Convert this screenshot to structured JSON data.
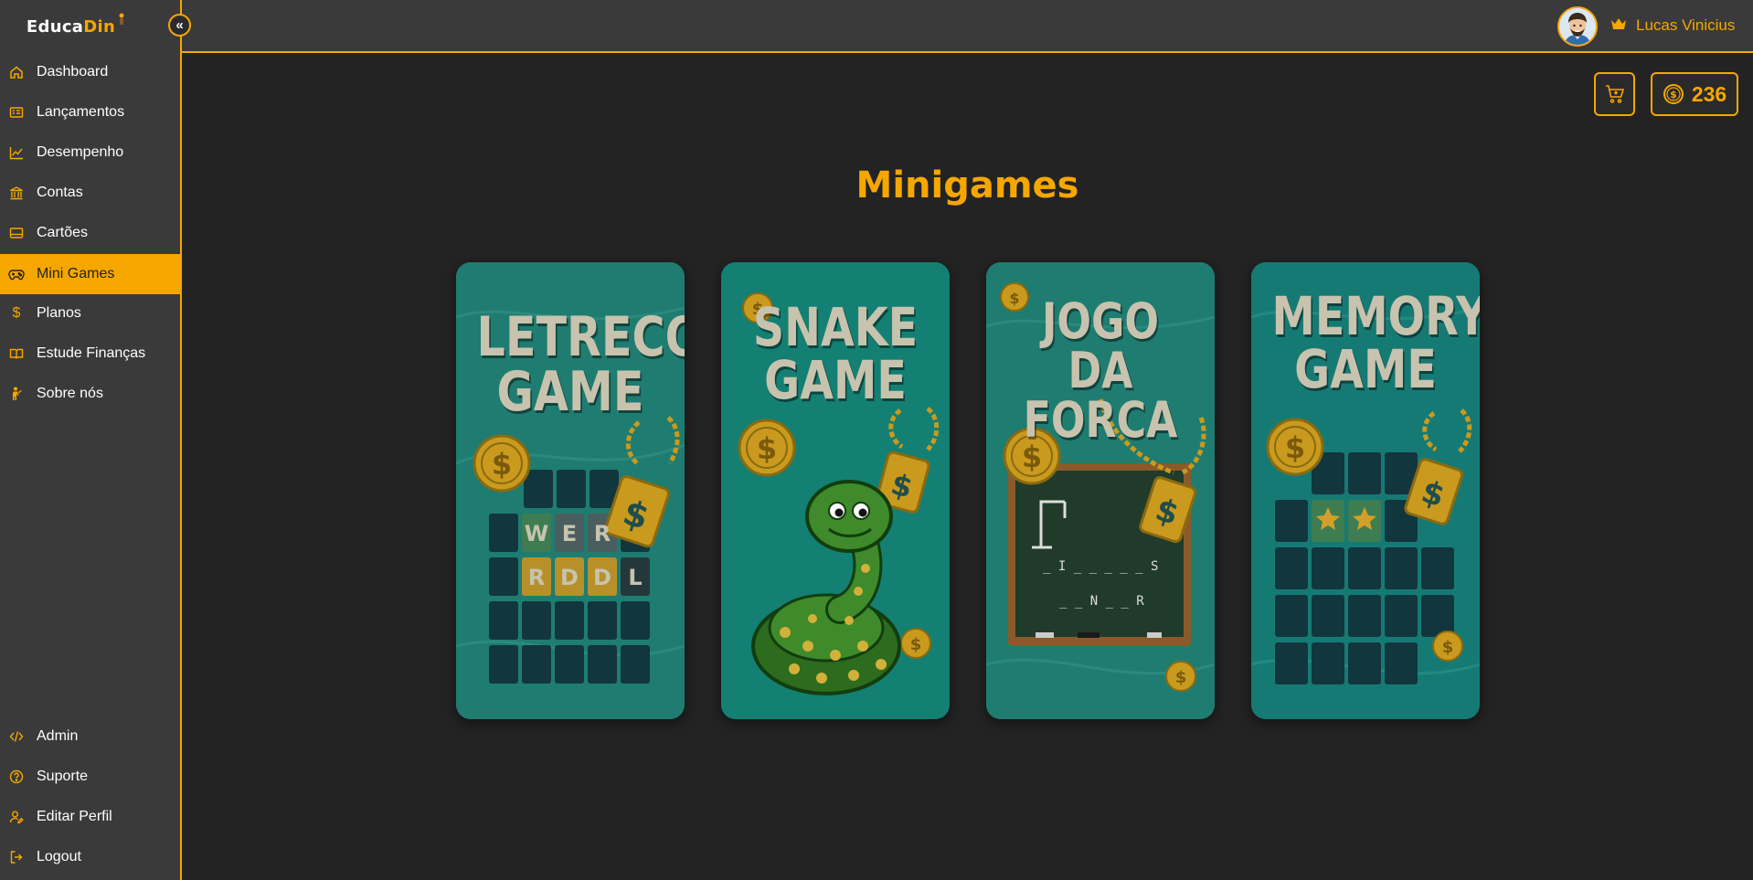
{
  "app": {
    "brand_part1": "Educa",
    "brand_part2": "Din"
  },
  "sidebar": {
    "collapse_glyph": "«",
    "items": [
      {
        "label": "Dashboard",
        "icon": "home-icon"
      },
      {
        "label": "Lançamentos",
        "icon": "list-icon"
      },
      {
        "label": "Desempenho",
        "icon": "trending-chart-icon"
      },
      {
        "label": "Contas",
        "icon": "bank-icon"
      },
      {
        "label": "Cartões",
        "icon": "credit-card-icon"
      },
      {
        "label": "Mini Games",
        "icon": "gamepad-icon",
        "active": true
      },
      {
        "label": "Planos",
        "icon": "dollar-icon"
      },
      {
        "label": "Estude Finanças",
        "icon": "book-icon"
      },
      {
        "label": "Sobre nós",
        "icon": "person-icon"
      }
    ],
    "bottom_items": [
      {
        "label": "Admin",
        "icon": "code-icon"
      },
      {
        "label": "Suporte",
        "icon": "help-circle-icon"
      },
      {
        "label": "Editar Perfil",
        "icon": "user-edit-icon"
      },
      {
        "label": "Logout",
        "icon": "logout-icon"
      }
    ]
  },
  "header": {
    "username": "Lucas Vinicius",
    "crown_icon": "crown-icon"
  },
  "wallet": {
    "coins": "236",
    "cart_icon": "cart-add-icon",
    "coin_icon": "coin-icon"
  },
  "main": {
    "title": "Minigames",
    "games": [
      {
        "title_line1": "LETRECO",
        "title_line2": "GAME",
        "tiles_row1": [
          "W",
          "E",
          "R"
        ],
        "tiles_row2": [
          "R",
          "D",
          "D",
          "L"
        ]
      },
      {
        "title_line1": "SNAKE",
        "title_line2": "GAME"
      },
      {
        "title_line1": "JOGO DA",
        "title_line2": "FORCA",
        "board_line1": "_ I _ _ _ _ _ S",
        "board_line2": "_ _ N _ _ R"
      },
      {
        "title_line1": "MEMORY",
        "title_line2": "GAME"
      }
    ]
  },
  "colors": {
    "accent": "#f5a700",
    "sidebar_bg": "#3a3a3a",
    "page_bg": "#232323",
    "card_bg": "#1f7c70"
  }
}
